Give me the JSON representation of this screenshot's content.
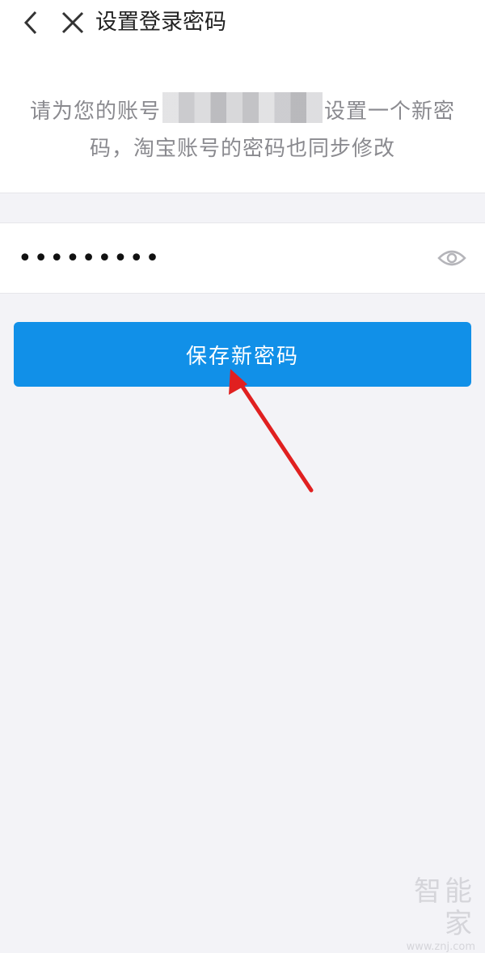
{
  "header": {
    "title": "设置登录密码",
    "back_icon": "back-arrow-icon",
    "close_icon": "close-icon"
  },
  "notice": {
    "text_before": "请为您的账号",
    "text_after": "设置一个新密码，淘宝账号的密码也同步修改"
  },
  "password_field": {
    "value": "•••••••••",
    "visibility_icon": "eye-icon"
  },
  "save_button": {
    "label": "保存新密码",
    "color": "#1190e8"
  },
  "annotation": {
    "arrow_color": "#e02020"
  },
  "watermark": {
    "main": "智能家",
    "url": "www.znj.com"
  }
}
